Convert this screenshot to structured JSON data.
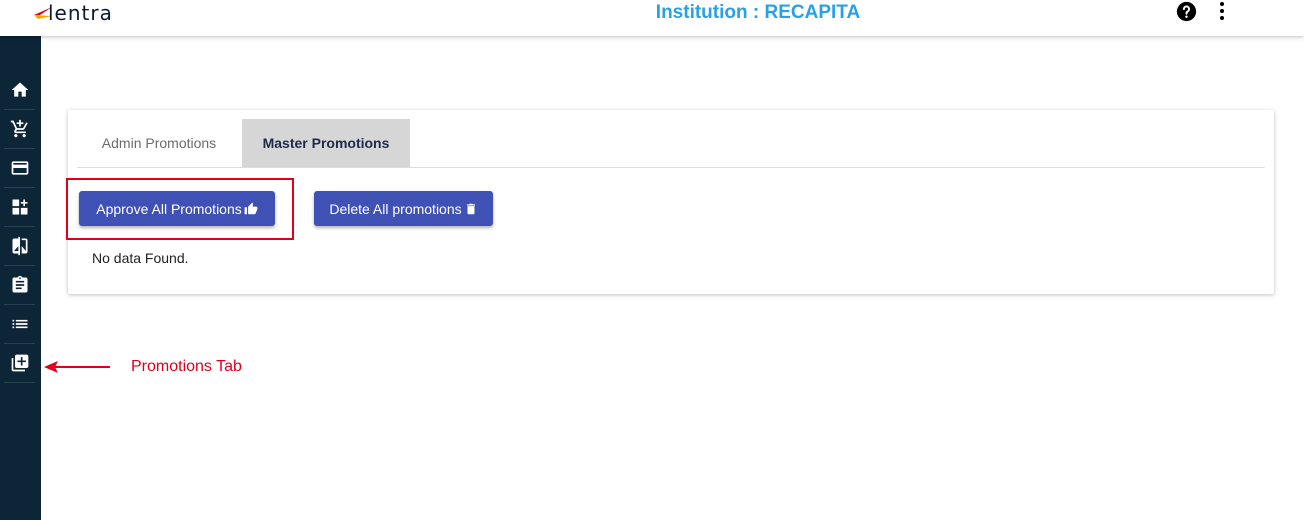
{
  "header": {
    "logo_text": "lentra",
    "institution_title": "Institution : RECAPITA",
    "icons": {
      "help": "help-circle-icon",
      "more": "more-vertical-icon"
    }
  },
  "sidebar": {
    "items": [
      {
        "icon": "home-icon"
      },
      {
        "icon": "cart-plus-icon"
      },
      {
        "icon": "credit-card-icon"
      },
      {
        "icon": "dashboard-add-icon"
      },
      {
        "icon": "compare-icon"
      },
      {
        "icon": "clipboard-icon"
      },
      {
        "icon": "list-icon"
      },
      {
        "icon": "library-add-icon"
      }
    ]
  },
  "tabs": [
    {
      "label": "Admin Promotions",
      "active": false
    },
    {
      "label": "Master Promotions",
      "active": true
    }
  ],
  "actions": {
    "approve_label": "Approve All Promotions",
    "approve_icon": "thumbs-up-icon",
    "delete_label": "Delete All promotions",
    "delete_icon": "trash-icon"
  },
  "content": {
    "empty_message": "No data Found."
  },
  "annotation": {
    "label": "Promotions Tab"
  },
  "colors": {
    "sidebar_bg": "#0c2537",
    "title": "#2aa0e6",
    "button": "#3f51b5",
    "annotation": "#e0001b"
  }
}
